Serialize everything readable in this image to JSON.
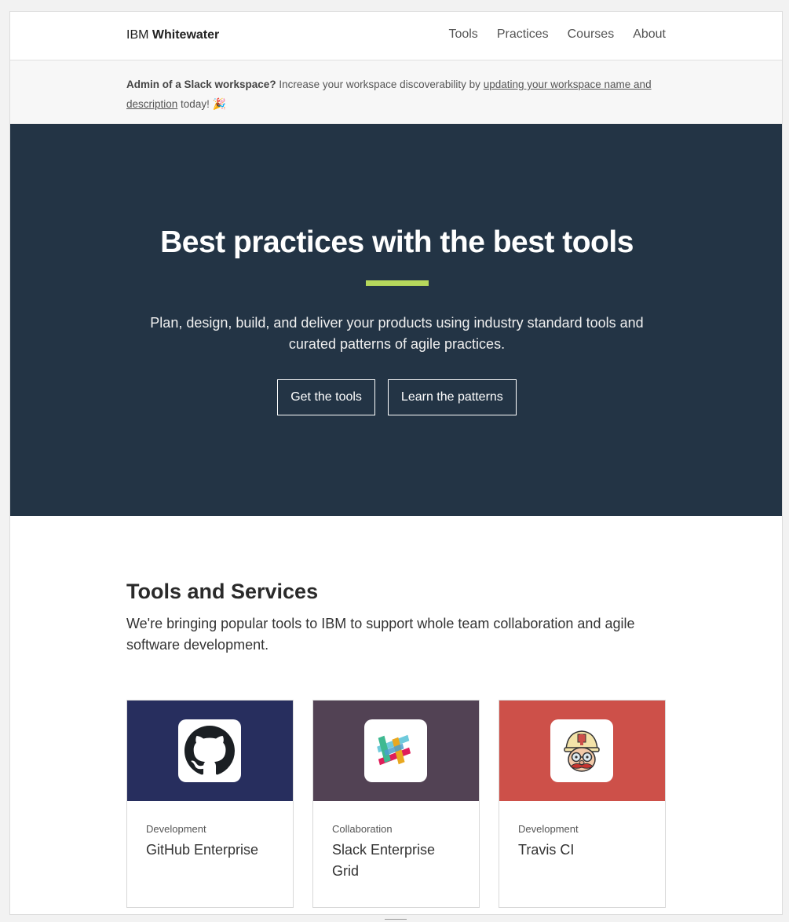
{
  "header": {
    "brand_light": "IBM",
    "brand_bold": "Whitewater",
    "nav": [
      "Tools",
      "Practices",
      "Courses",
      "About"
    ]
  },
  "banner": {
    "lead": "Admin of a Slack workspace?",
    "text": " Increase your workspace discoverability by ",
    "link": "updating your workspace name and description",
    "tail": " today! ",
    "emoji": "🎉"
  },
  "hero": {
    "title": "Best practices with the best tools",
    "subtitle": "Plan, design, build, and deliver your products using industry standard tools and curated patterns of agile practices.",
    "button_tools": "Get the tools",
    "button_patterns": "Learn the patterns",
    "accent_color": "#b6d85c",
    "background": "#233445"
  },
  "tools": {
    "title": "Tools and Services",
    "subtitle": "We're bringing popular tools to IBM to support whole team collaboration and agile software development.",
    "cards": [
      {
        "category": "Development",
        "name": "GitHub Enterprise",
        "icon": "github-icon",
        "color": "#272e5e"
      },
      {
        "category": "Collaboration",
        "name": "Slack Enterprise Grid",
        "icon": "slack-icon",
        "color": "#524254"
      },
      {
        "category": "Development",
        "name": "Travis CI",
        "icon": "travis-icon",
        "color": "#cd5049"
      }
    ]
  }
}
